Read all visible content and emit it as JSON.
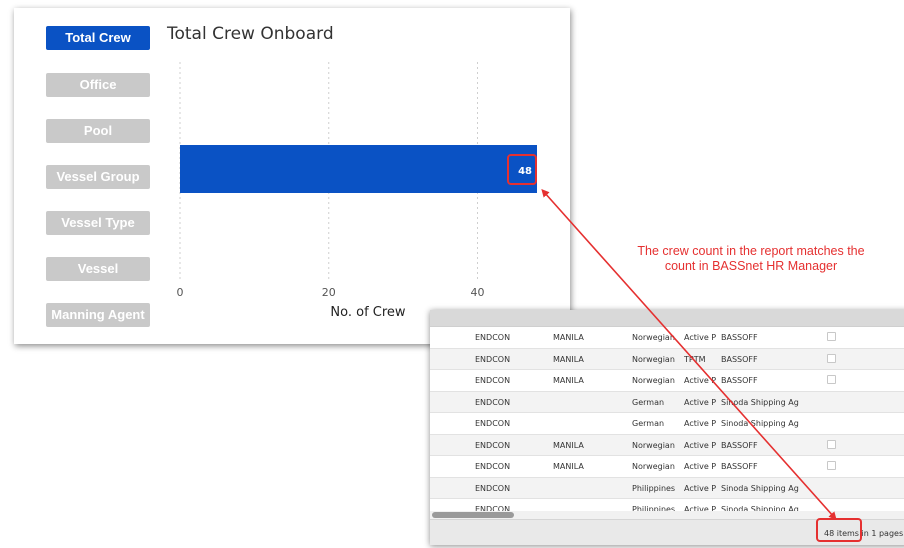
{
  "sidebar": {
    "buttons": [
      {
        "label": "Total Crew",
        "active": true
      },
      {
        "label": "Office",
        "active": false
      },
      {
        "label": "Pool",
        "active": false
      },
      {
        "label": "Vessel Group",
        "active": false
      },
      {
        "label": "Vessel Type",
        "active": false
      },
      {
        "label": "Vessel",
        "active": false
      },
      {
        "label": "Manning Agent",
        "active": false
      }
    ]
  },
  "chart": {
    "title": "Total Crew Onboard"
  },
  "chart_data": {
    "type": "bar",
    "orientation": "horizontal",
    "title": "Total Crew Onboard",
    "xlabel": "No. of Crew",
    "ylabel": "",
    "categories": [
      ""
    ],
    "values": [
      48
    ],
    "data_labels": [
      "48"
    ],
    "xlim": [
      0,
      48
    ],
    "xticks": [
      0,
      20,
      40
    ],
    "xtick_labels": [
      "0",
      "20",
      "40"
    ],
    "grid": "vertical dotted",
    "bar_color": "#0a52c4"
  },
  "grid": {
    "rows": [
      {
        "c1": "ENDCON",
        "c2": "MANILA",
        "c3": "Norwegian",
        "c4": "Active Pc",
        "c5": "BASSOFF",
        "check": true
      },
      {
        "c1": "ENDCON",
        "c2": "MANILA",
        "c3": "Norwegian",
        "c4": "TPTM",
        "c5": "BASSOFF",
        "check": true
      },
      {
        "c1": "ENDCON",
        "c2": "MANILA",
        "c3": "Norwegian",
        "c4": "Active Pc",
        "c5": "BASSOFF",
        "check": true
      },
      {
        "c1": "ENDCON",
        "c2": "",
        "c3": "German",
        "c4": "Active Pc",
        "c5": "Sinoda Shipping Ag",
        "check": false
      },
      {
        "c1": "ENDCON",
        "c2": "",
        "c3": "German",
        "c4": "Active Pc",
        "c5": "Sinoda Shipping Ag",
        "check": false
      },
      {
        "c1": "ENDCON",
        "c2": "MANILA",
        "c3": "Norwegian",
        "c4": "Active Pc",
        "c5": "BASSOFF",
        "check": true
      },
      {
        "c1": "ENDCON",
        "c2": "MANILA",
        "c3": "Norwegian",
        "c4": "Active Pc",
        "c5": "BASSOFF",
        "check": true
      },
      {
        "c1": "ENDCON",
        "c2": "",
        "c3": "Philippines",
        "c4": "Active Pc",
        "c5": "Sinoda Shipping Ag",
        "check": false
      },
      {
        "c1": "ENDCON",
        "c2": "",
        "c3": "Philippines",
        "c4": "Active Pc",
        "c5": "Sinoda Shipping Ag",
        "check": false
      }
    ],
    "pager_text": "48 items in 1 pages"
  },
  "annotation": {
    "line1": "The crew count in the report matches the",
    "line2": "count in BASSnet HR Manager",
    "color": "#e53030"
  }
}
